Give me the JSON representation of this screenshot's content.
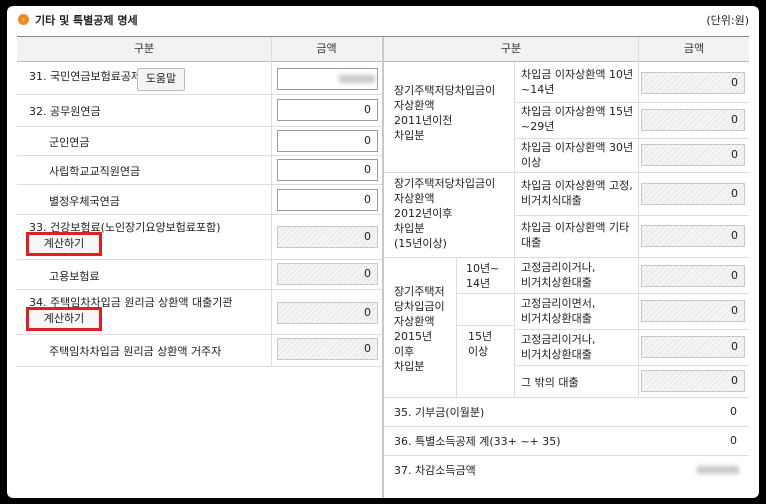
{
  "header": {
    "title": "기타 및 특별공제 명세",
    "unit": "(단위:원)"
  },
  "columns": {
    "gubun_left": "구분",
    "amount_left": "금액",
    "gubun_right": "구분",
    "amount_right": "금액"
  },
  "left": {
    "r31": {
      "label": "31. 국민연금보험료공제",
      "help_btn": "도움말"
    },
    "r32": {
      "label": "32. 공무원연금",
      "value": "0"
    },
    "r32a": {
      "label": "군인연금",
      "value": "0"
    },
    "r32b": {
      "label": "사립학교교직원연금",
      "value": "0"
    },
    "r32c": {
      "label": "별정우체국연금",
      "value": "0"
    },
    "r33": {
      "label": "33. 건강보험료(노인장기요양보험료포함)",
      "calc_btn": "계산하기",
      "value": "0"
    },
    "r33a": {
      "label": "고용보험료",
      "value": "0"
    },
    "r34": {
      "label": "34. 주택임차차입금 원리금 상환액 대출기관",
      "calc_btn": "계산하기",
      "value": "0"
    },
    "r34a": {
      "label": "주택임차차입금 원리금 상환액 거주자",
      "value": "0"
    }
  },
  "right": {
    "g2011": {
      "lines": [
        "장기주택저당차입금이",
        "자상환액",
        "2011년이전",
        "차입분"
      ]
    },
    "s10": {
      "lines": [
        "차입금 이자상환액 10년",
        "~14년"
      ],
      "value": "0"
    },
    "s15": {
      "lines": [
        "차입금 이자상환액 15년",
        "~29년"
      ],
      "value": "0"
    },
    "s30": {
      "lines": [
        "차입금 이자상환액 30년",
        "이상"
      ],
      "value": "0"
    },
    "g2012": {
      "lines": [
        "장기주택저당차입금이",
        "자상환액",
        "2012년이후",
        "차입분",
        "(15년이상)"
      ]
    },
    "sfix": {
      "lines": [
        "차입금 이자상환액 고정,",
        "비거치식대출"
      ],
      "value": "0"
    },
    "setc": {
      "lines": [
        "차입금 이자상환액 기타",
        "대출"
      ],
      "value": "0"
    },
    "g2015": {
      "lines": [
        "장기주택저",
        "당차입금이",
        "자상환액",
        "2015년",
        "이후",
        "차입분"
      ]
    },
    "p10": {
      "lines": [
        "10년~",
        "14년"
      ]
    },
    "p15": {
      "lines": [
        "15년",
        "이상"
      ]
    },
    "t1": {
      "lines": [
        "고정금리이거나,",
        "비거치상환대출"
      ],
      "value": "0"
    },
    "t2": {
      "lines": [
        "고정금리이면서,",
        "비거치상환대출"
      ],
      "value": "0"
    },
    "t3": {
      "lines": [
        "고정금리이거나,",
        "비거치상환대출"
      ],
      "value": "0"
    },
    "t4": {
      "label": "그 밖의 대출",
      "value": "0"
    },
    "r35": {
      "label": "35. 기부금(이월분)",
      "value": "0"
    },
    "r36": {
      "label": "36. 특별소득공제 계(33+ ~+ 35)",
      "value": "0"
    },
    "r37": {
      "label": "37. 차감소득금액"
    }
  }
}
